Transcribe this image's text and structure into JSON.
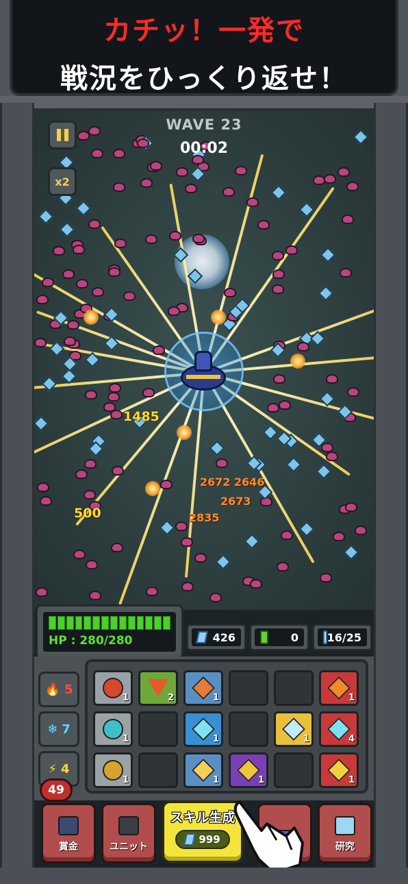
{
  "banner": {
    "line1": "カチッ！一発で",
    "line2": "戦況をひっくり返せ！"
  },
  "hud": {
    "pause_icon": "pause-icon",
    "speed_label": "x2",
    "wave_label": "WAVE 23",
    "timer": "00:02"
  },
  "damage_numbers": [
    "1485",
    "500",
    "2672",
    "2646",
    "2673",
    "2835"
  ],
  "status": {
    "hp_text": "HP : 280/280",
    "hp_fraction": 1.0,
    "hp_segments": 14,
    "crystals": "426",
    "energy": "0",
    "cards": "16/25"
  },
  "elements": [
    {
      "icon": "flame-icon",
      "glyph": "🔥",
      "count": "5",
      "color": "#ff4b3b"
    },
    {
      "icon": "snowflake-icon",
      "glyph": "❄",
      "count": "7",
      "color": "#5fd7ff"
    },
    {
      "icon": "lightning-icon",
      "glyph": "⚡",
      "count": "4",
      "color": "#ffd63a"
    }
  ],
  "skill_grid": [
    {
      "icon": "fire-orb-icon",
      "level": "1",
      "bg": "#9aa2a6",
      "color": "#d9482e",
      "kind": "orb"
    },
    {
      "icon": "fire-triangle-icon",
      "level": "2",
      "bg": "#6ea83a",
      "color": "#e65a2a",
      "kind": "tri"
    },
    {
      "icon": "fire-diamond-icon",
      "level": "1",
      "bg": "#5a8fc4",
      "color": "#e87a3a",
      "kind": "shape"
    },
    {
      "icon": "empty-slot",
      "level": "",
      "bg": "",
      "color": "",
      "kind": "empty"
    },
    {
      "icon": "empty-slot",
      "level": "",
      "bg": "",
      "color": "",
      "kind": "empty"
    },
    {
      "icon": "fire-star-icon",
      "level": "1",
      "bg": "#c9393a",
      "color": "#f08a2a",
      "kind": "shape"
    },
    {
      "icon": "ice-orb-icon",
      "level": "1",
      "bg": "#9aa2a6",
      "color": "#3ec0c8",
      "kind": "orb"
    },
    {
      "icon": "empty-slot",
      "level": "",
      "bg": "",
      "color": "",
      "kind": "empty"
    },
    {
      "icon": "ice-swirl-icon",
      "level": "1",
      "bg": "#3a8fd1",
      "color": "#7fe3f0",
      "kind": "shape"
    },
    {
      "icon": "empty-slot",
      "level": "",
      "bg": "",
      "color": "",
      "kind": "empty"
    },
    {
      "icon": "ice-pentagon-icon",
      "level": "1",
      "bg": "#e9c03a",
      "color": "#bfeaf7",
      "kind": "shape"
    },
    {
      "icon": "ice-star-icon",
      "level": "4",
      "bg": "#c9393a",
      "color": "#7fdff2",
      "kind": "shape"
    },
    {
      "icon": "bolt-orb-icon",
      "level": "1",
      "bg": "#9aa2a6",
      "color": "#d4a52a",
      "kind": "orb"
    },
    {
      "icon": "empty-slot",
      "level": "",
      "bg": "",
      "color": "",
      "kind": "empty"
    },
    {
      "icon": "bolt-diamond-icon",
      "level": "1",
      "bg": "#5a8fc4",
      "color": "#f2cf56",
      "kind": "shape"
    },
    {
      "icon": "bolt-square-icon",
      "level": "1",
      "bg": "#7a3fb6",
      "color": "#f0c53a",
      "kind": "shape"
    },
    {
      "icon": "empty-slot",
      "level": "",
      "bg": "",
      "color": "",
      "kind": "empty"
    },
    {
      "icon": "bolt-star-icon",
      "level": "1",
      "bg": "#c9393a",
      "color": "#f2d040",
      "kind": "shape"
    }
  ],
  "nav": {
    "badge_count": "49",
    "bounty_label": "賞金",
    "unit_label": "ユニット",
    "skill_label": "スキル生成",
    "skill_cost": "999",
    "research_label": "研究"
  }
}
